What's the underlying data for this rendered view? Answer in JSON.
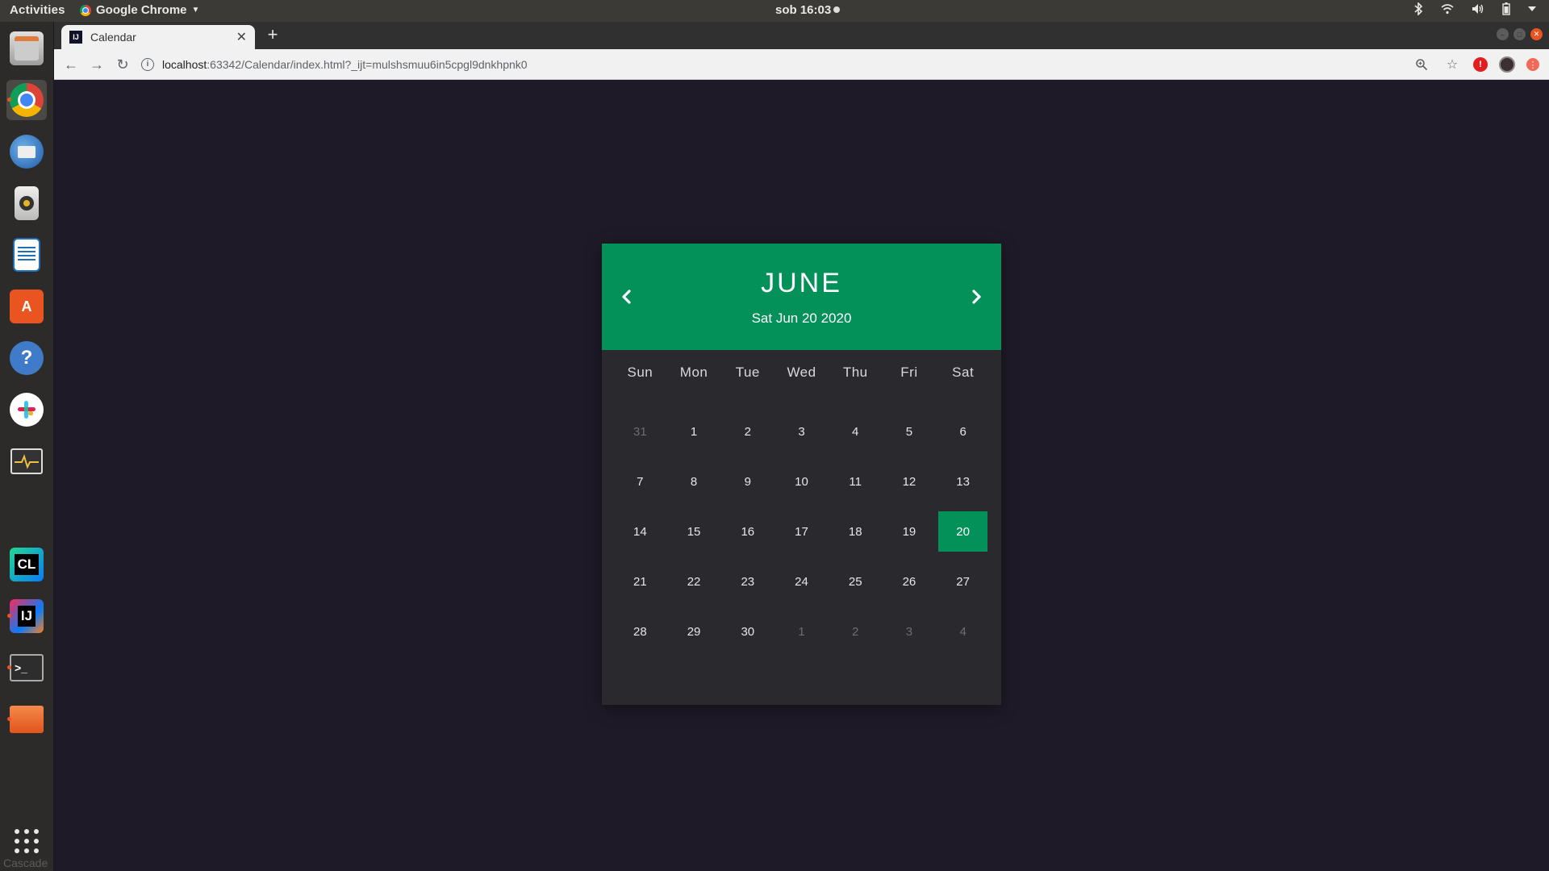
{
  "topbar": {
    "activities": "Activities",
    "app_name": "Google Chrome",
    "clock": "sob 16:03"
  },
  "dock": {
    "items": [
      {
        "name": "files-manager",
        "label": "FILE"
      },
      {
        "name": "chrome",
        "label": ""
      },
      {
        "name": "thunderbird",
        "label": ""
      },
      {
        "name": "rhythmbox",
        "label": ""
      },
      {
        "name": "libreoffice-writer",
        "label": ""
      },
      {
        "name": "ubuntu-software",
        "label": "A"
      },
      {
        "name": "help",
        "label": "?"
      },
      {
        "name": "slack",
        "label": ""
      },
      {
        "name": "system-monitor",
        "label": ""
      },
      {
        "name": "tiles-app",
        "label": ""
      },
      {
        "name": "clion",
        "label": "CL"
      },
      {
        "name": "intellij",
        "label": "IJ"
      },
      {
        "name": "terminal",
        "label": ">_"
      },
      {
        "name": "folder",
        "label": ""
      }
    ],
    "cascade": "Cascade"
  },
  "browser": {
    "tab_title": "Calendar",
    "tab_favicon": "IJ",
    "url_host": "localhost",
    "url_path": ":63342/Calendar/index.html?_ijt=mulshsmuu6in5cpgl9dnkhpnk0"
  },
  "calendar": {
    "month": "JUNE",
    "date_label": "Sat Jun 20 2020",
    "weekdays": [
      "Sun",
      "Mon",
      "Tue",
      "Wed",
      "Thu",
      "Fri",
      "Sat"
    ],
    "days": [
      {
        "n": "31",
        "muted": true
      },
      {
        "n": "1"
      },
      {
        "n": "2"
      },
      {
        "n": "3"
      },
      {
        "n": "4"
      },
      {
        "n": "5"
      },
      {
        "n": "6"
      },
      {
        "n": "7"
      },
      {
        "n": "8"
      },
      {
        "n": "9"
      },
      {
        "n": "10"
      },
      {
        "n": "11"
      },
      {
        "n": "12"
      },
      {
        "n": "13"
      },
      {
        "n": "14"
      },
      {
        "n": "15"
      },
      {
        "n": "16"
      },
      {
        "n": "17"
      },
      {
        "n": "18"
      },
      {
        "n": "19"
      },
      {
        "n": "20",
        "today": true
      },
      {
        "n": "21"
      },
      {
        "n": "22"
      },
      {
        "n": "23"
      },
      {
        "n": "24"
      },
      {
        "n": "25"
      },
      {
        "n": "26"
      },
      {
        "n": "27"
      },
      {
        "n": "28"
      },
      {
        "n": "29"
      },
      {
        "n": "30"
      },
      {
        "n": "1",
        "muted": true
      },
      {
        "n": "2",
        "muted": true
      },
      {
        "n": "3",
        "muted": true
      },
      {
        "n": "4",
        "muted": true
      }
    ],
    "accent_color": "#049059",
    "background_color": "#2a292d"
  }
}
